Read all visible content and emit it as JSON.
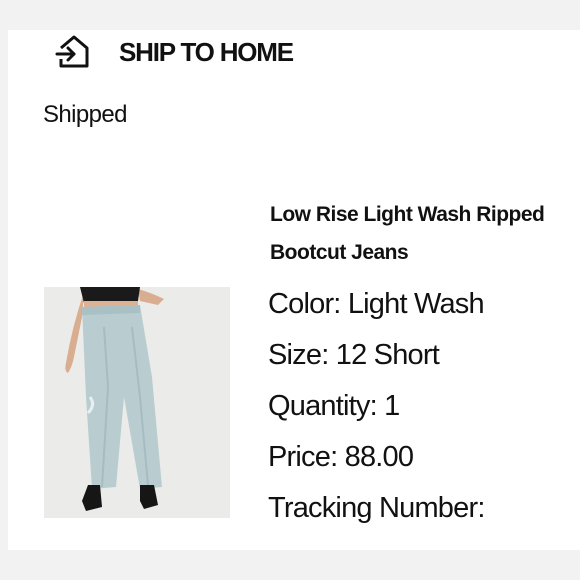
{
  "shipping": {
    "icon": "ship-to-home-icon",
    "title": "SHIP TO HOME",
    "status": "Shipped"
  },
  "product": {
    "name": "Low Rise Light Wash Ripped\nBootcut Jeans",
    "image": "light-wash-bootcut-jeans-photo",
    "details": [
      {
        "label": "Color:",
        "value": "Light Wash"
      },
      {
        "label": "Size:",
        "value": "12 Short"
      },
      {
        "label": "Quantity:",
        "value": "1"
      },
      {
        "label": "Price:",
        "value": "88.00"
      },
      {
        "label": "Tracking Number:",
        "value": ""
      }
    ]
  },
  "colors": {
    "background": "#f2f2f2",
    "card": "#ffffff",
    "denim": "#b8ccd0"
  }
}
